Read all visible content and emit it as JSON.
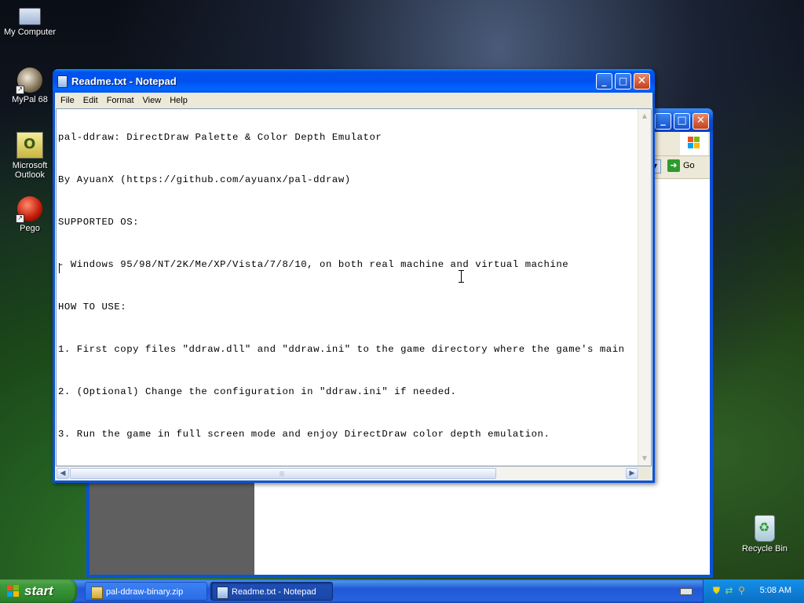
{
  "desktop": {
    "icons": [
      {
        "label": "My Computer"
      },
      {
        "label": "MyPal 68"
      },
      {
        "label": "Microsoft Outlook"
      },
      {
        "label": "Pego"
      },
      {
        "label": "Recycle Bin"
      }
    ]
  },
  "background_window": {
    "go_label": "Go"
  },
  "notepad": {
    "title": "Readme.txt - Notepad",
    "menu": [
      "File",
      "Edit",
      "Format",
      "View",
      "Help"
    ],
    "lines": [
      "pal-ddraw: DirectDraw Palette & Color Depth Emulator",
      "By AyuanX (https://github.com/ayuanx/pal-ddraw)",
      "SUPPORTED OS:",
      "- Windows 95/98/NT/2K/Me/XP/Vista/7/8/10, on both real machine and virtual machine",
      "HOW TO USE:",
      "1. First copy files \"ddraw.dll\" and \"ddraw.ini\" to the game directory where the game's main",
      "2. (Optional) Change the configuration in \"ddraw.ini\" if needed.",
      "3. Run the game in full screen mode and enjoy DirectDraw color depth emulation."
    ]
  },
  "taskbar": {
    "start_label": "start",
    "buttons": [
      {
        "label": "pal-ddraw-binary.zip",
        "active": false
      },
      {
        "label": "Readme.txt - Notepad",
        "active": true
      }
    ],
    "clock": "5:08 AM"
  },
  "colors": {
    "xp_blue": "#0053ee",
    "start_green": "#3c9a3a",
    "close_red": "#c23f1c"
  }
}
